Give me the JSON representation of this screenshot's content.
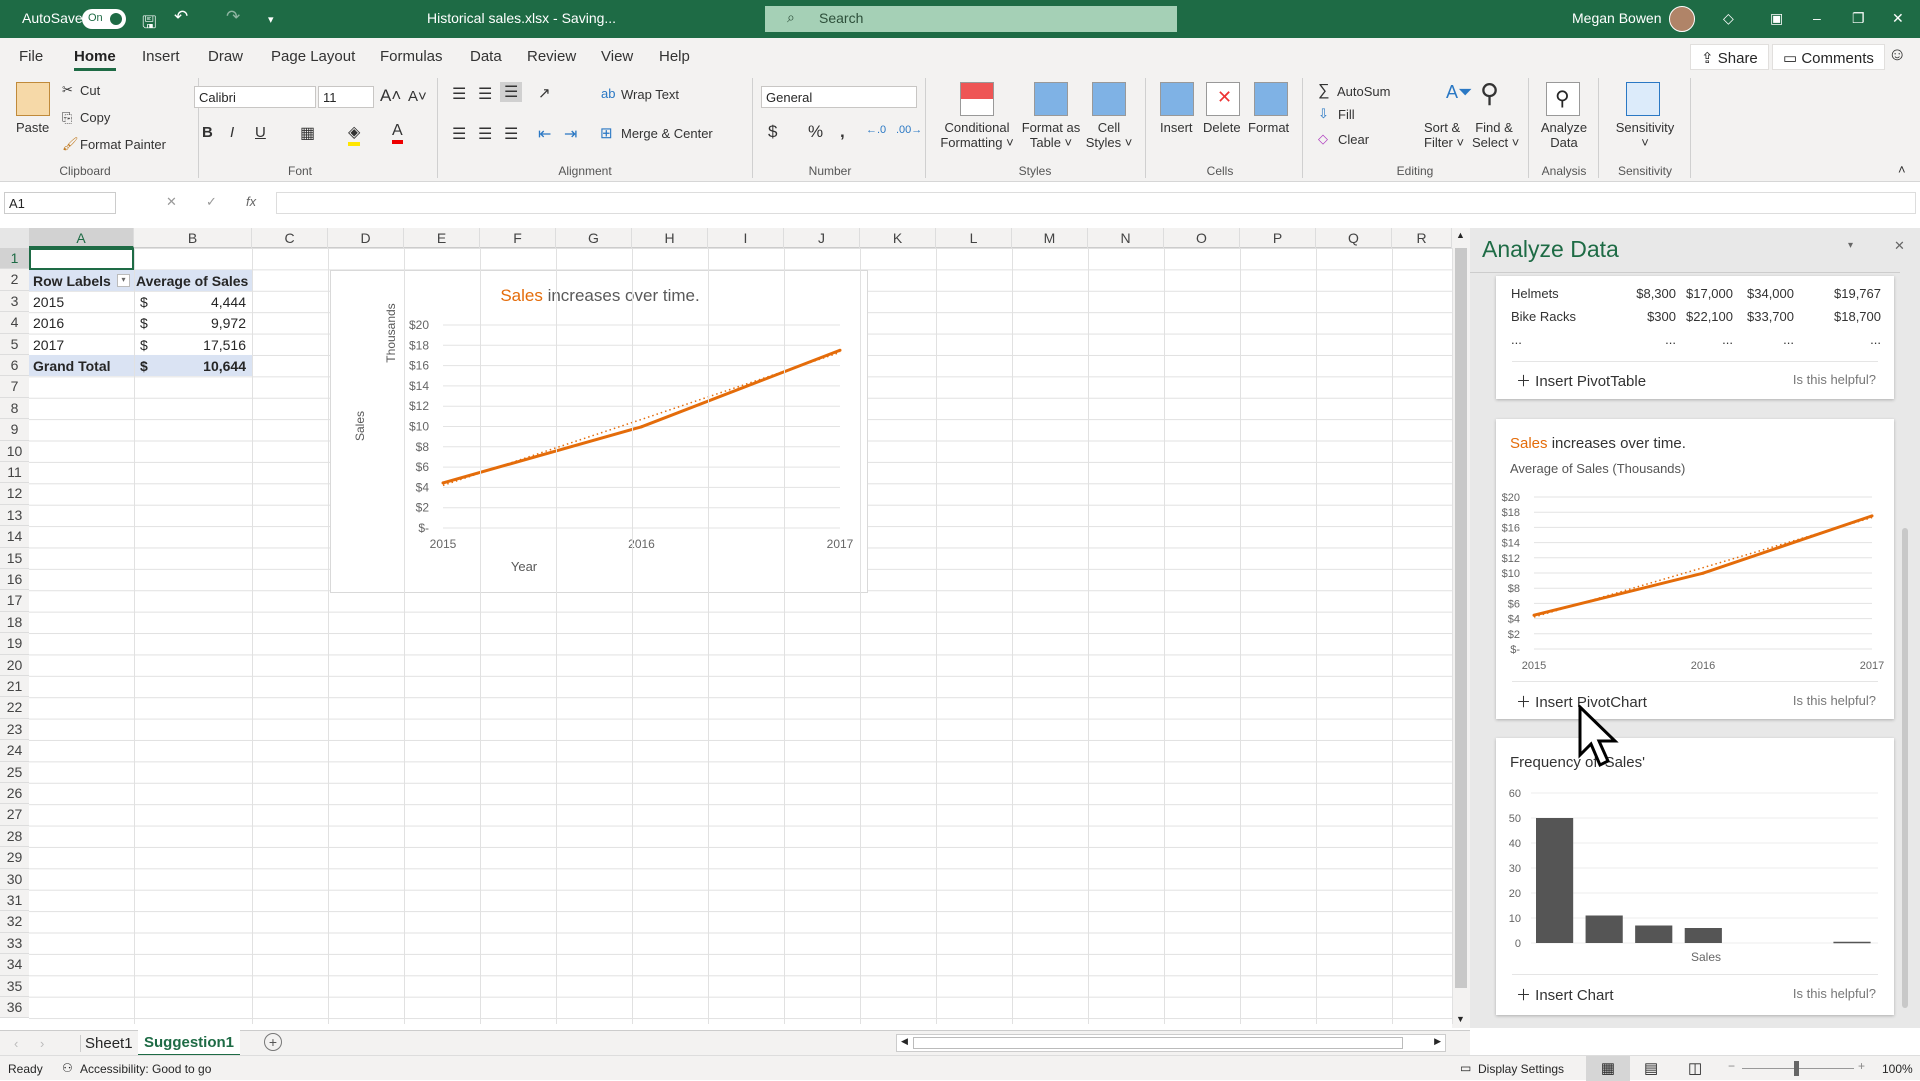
{
  "titlebar": {
    "autosave_label": "AutoSave",
    "autosave_state": "On",
    "doc_title": "Historical sales.xlsx  -  Saving...",
    "search_placeholder": "Search",
    "user_name": "Megan Bowen"
  },
  "menu": {
    "tabs": [
      "File",
      "Home",
      "Insert",
      "Draw",
      "Page Layout",
      "Formulas",
      "Data",
      "Review",
      "View",
      "Help"
    ],
    "active": "Home",
    "share": "Share",
    "comments": "Comments"
  },
  "ribbon": {
    "clipboard": {
      "paste": "Paste",
      "cut": "Cut",
      "copy": "Copy",
      "format_painter": "Format Painter",
      "label": "Clipboard"
    },
    "font": {
      "name": "Calibri",
      "size": "11",
      "label": "Font",
      "bold": "B",
      "italic": "I",
      "underline": "U"
    },
    "alignment": {
      "wrap": "Wrap Text",
      "merge": "Merge & Center",
      "label": "Alignment"
    },
    "number": {
      "format": "General",
      "label": "Number"
    },
    "styles": {
      "conditional": "Conditional",
      "conditional2": "Formatting",
      "format_table": "Format as",
      "format_table2": "Table",
      "cell_styles": "Cell",
      "cell_styles2": "Styles",
      "label": "Styles"
    },
    "cells": {
      "insert": "Insert",
      "delete": "Delete",
      "format": "Format",
      "label": "Cells"
    },
    "editing": {
      "autosum": "AutoSum",
      "fill": "Fill",
      "clear": "Clear",
      "sort": "Sort &",
      "sort2": "Filter",
      "find": "Find &",
      "find2": "Select",
      "label": "Editing"
    },
    "analysis": {
      "analyze": "Analyze",
      "analyze2": "Data",
      "label": "Analysis"
    },
    "sensitivity": {
      "btn": "Sensitivity",
      "label": "Sensitivity"
    }
  },
  "formula_bar": {
    "name_box": "A1",
    "fx": "fx",
    "value": ""
  },
  "sheet": {
    "columns": [
      "A",
      "B",
      "C",
      "D",
      "E",
      "F",
      "G",
      "H",
      "I",
      "J",
      "K",
      "L",
      "M",
      "N",
      "O",
      "P",
      "Q",
      "R"
    ],
    "rows": [
      "1",
      "2",
      "3",
      "4",
      "5",
      "6",
      "7",
      "8",
      "9",
      "10",
      "11",
      "12",
      "13",
      "14",
      "15",
      "16",
      "17",
      "18",
      "19",
      "20",
      "21",
      "22",
      "23",
      "24",
      "25",
      "26",
      "27",
      "28",
      "29",
      "30",
      "31",
      "32",
      "33",
      "34",
      "35",
      "36"
    ],
    "pivot": {
      "header": [
        "Row Labels",
        "Average of Sales"
      ],
      "rows": [
        [
          "2015",
          "$",
          "4,444"
        ],
        [
          "2016",
          "$",
          "9,972"
        ],
        [
          "2017",
          "$",
          "17,516"
        ]
      ],
      "total": [
        "Grand Total",
        "$",
        "10,644"
      ]
    }
  },
  "chart_data": [
    {
      "type": "line",
      "title_highlight": "Sales",
      "title_rest": " increases over time.",
      "xlabel": "Year",
      "ylabel": "Sales",
      "ylabel_units": "Thousands",
      "categories": [
        "2015",
        "2016",
        "2017"
      ],
      "series": [
        {
          "values": [
            4.444,
            9.972,
            17.516
          ],
          "color": "#e46c0a"
        }
      ],
      "trendline": [
        4.2,
        10.7,
        17.3
      ],
      "yticks": [
        "$-",
        "$2",
        "$4",
        "$6",
        "$8",
        "$10",
        "$12",
        "$14",
        "$16",
        "$18",
        "$20"
      ],
      "ylim": [
        0,
        20
      ],
      "grid": true
    },
    {
      "type": "line",
      "title_highlight": "Sales",
      "title_rest": " increases over time.",
      "subtitle": "Average of Sales (Thousands)",
      "categories": [
        "2015",
        "2016",
        "2017"
      ],
      "series": [
        {
          "values": [
            4.444,
            9.972,
            17.516
          ],
          "color": "#e46c0a"
        }
      ],
      "trendline": [
        4.2,
        10.7,
        17.3
      ],
      "yticks": [
        "$-",
        "$2",
        "$4",
        "$6",
        "$8",
        "$10",
        "$12",
        "$14",
        "$16",
        "$18",
        "$20"
      ],
      "ylim": [
        0,
        20
      ],
      "grid": true
    },
    {
      "type": "bar",
      "title": "Frequency of 'Sales'",
      "xlabel": "Sales",
      "values": [
        50,
        11,
        7,
        6,
        0,
        0,
        0.5
      ],
      "yticks": [
        "0",
        "10",
        "20",
        "30",
        "40",
        "50",
        "60"
      ],
      "ylim": [
        0,
        60
      ],
      "grid": true,
      "color": "#555555"
    }
  ],
  "pane": {
    "title": "Analyze Data",
    "table": {
      "rows": [
        [
          "Helmets",
          "$8,300",
          "$17,000",
          "$34,000",
          "$19,767"
        ],
        [
          "Bike Racks",
          "$300",
          "$22,100",
          "$33,700",
          "$18,700"
        ],
        [
          "...",
          "...",
          "...",
          "...",
          "..."
        ]
      ]
    },
    "card1_action": "Insert PivotTable",
    "card2_action": "Insert PivotChart",
    "card3_action": "Insert Chart",
    "helpful": "Is this helpful?"
  },
  "sheet_tabs": {
    "tabs": [
      "Sheet1",
      "Suggestion1"
    ],
    "active": "Suggestion1"
  },
  "status": {
    "ready": "Ready",
    "accessibility": "Accessibility: Good to go",
    "display_settings": "Display Settings",
    "zoom": "100%"
  },
  "colors": {
    "brand": "#1e6b45",
    "accent": "#e46c0a"
  }
}
